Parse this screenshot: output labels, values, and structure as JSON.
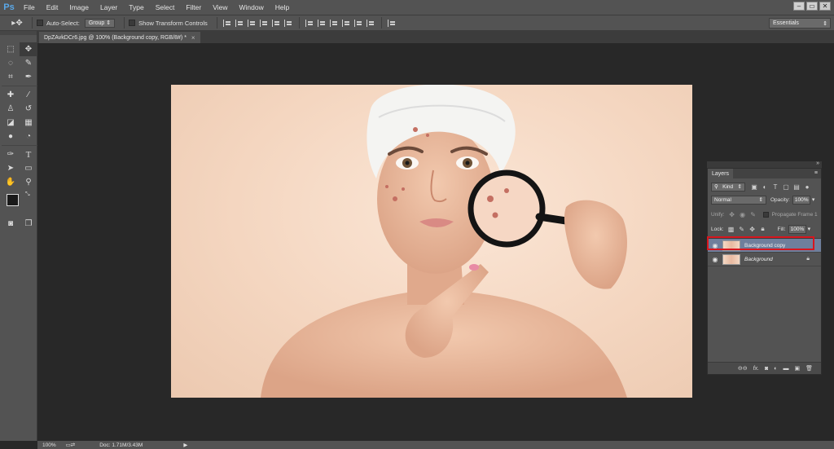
{
  "app": {
    "logo": "Ps",
    "menu": [
      "File",
      "Edit",
      "Image",
      "Layer",
      "Type",
      "Select",
      "Filter",
      "View",
      "Window",
      "Help"
    ],
    "window_controls": [
      "–",
      "▭",
      "✕"
    ]
  },
  "options_bar": {
    "auto_select_label": "Auto-Select:",
    "auto_select_value": "Group",
    "transform_label": "Show Transform Controls",
    "workspace": "Essentials"
  },
  "document": {
    "tab_title": "DpZAvkDCr6.jpg @ 100% (Background copy, RGB/8#) *",
    "tab_close": "×"
  },
  "status_bar": {
    "zoom": "100%",
    "doc_info": "Doc: 1.71M/3.43M"
  },
  "layers_panel": {
    "tab_label": "Layers",
    "filter_kind": "Kind",
    "blend_mode": "Normal",
    "opacity_label": "Opacity:",
    "opacity_value": "100%",
    "unify_label": "Unify:",
    "propagate_label": "Propagate Frame 1",
    "lock_label": "Lock:",
    "fill_label": "Fill:",
    "fill_value": "100%",
    "layers": [
      {
        "name": "Background copy",
        "selected": true,
        "locked": false
      },
      {
        "name": "Background",
        "selected": false,
        "locked": true
      }
    ]
  },
  "colors": {
    "highlight_box": "#d8161e",
    "selected_layer": "#6f7f9c"
  }
}
